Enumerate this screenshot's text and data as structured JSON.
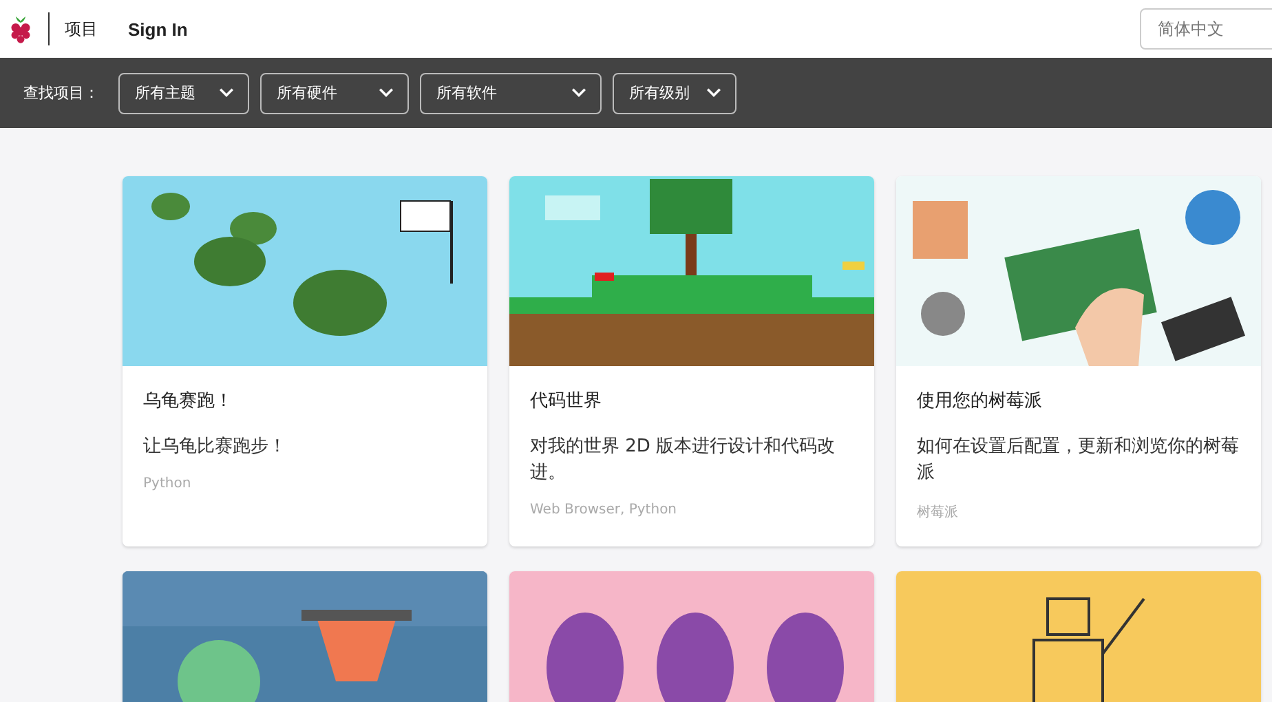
{
  "header": {
    "nav": [
      {
        "label": "项目"
      },
      {
        "label": "Sign In"
      }
    ],
    "language": {
      "placeholder": "简体中文"
    }
  },
  "filter_bar": {
    "label": "查找项目：",
    "dropdowns": [
      {
        "label": "所有主题"
      },
      {
        "label": "所有硬件"
      },
      {
        "label": "所有软件"
      },
      {
        "label": "所有级别"
      }
    ]
  },
  "cards": [
    {
      "kind": "project",
      "title": "乌龟赛跑！",
      "description": "让乌龟比赛跑步！",
      "tags": "Python"
    },
    {
      "kind": "project",
      "title": "代码世界",
      "description": "对我的世界 2D 版本进行设计和代码改进。",
      "tags": "Web Browser, Python"
    },
    {
      "kind": "project",
      "title": "使用您的树莓派",
      "description": "如何在设置后配置，更新和浏览你的树莓派",
      "tags": "树莓派"
    },
    {
      "kind": "picture"
    },
    {
      "kind": "picture"
    },
    {
      "kind": "picture"
    }
  ]
}
